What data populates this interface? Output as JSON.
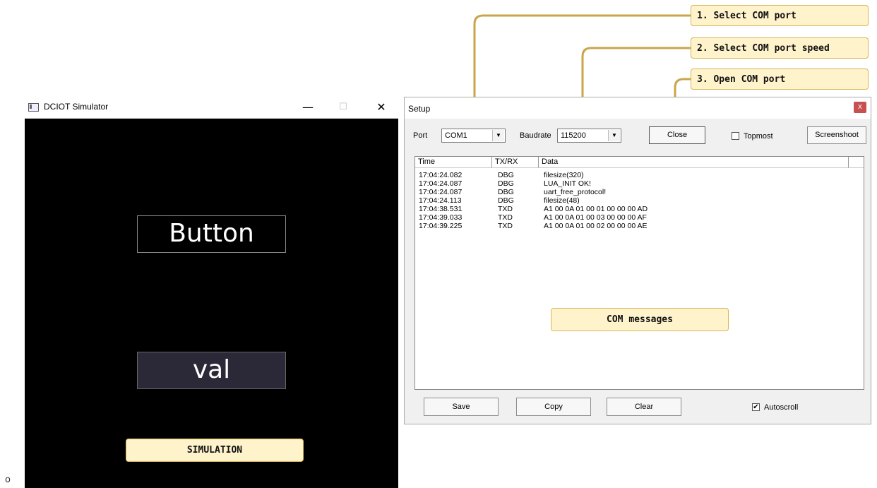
{
  "simulator": {
    "title": "DCIOT Simulator",
    "minimize_glyph": "—",
    "maximize_glyph": "☐",
    "close_glyph": "✕",
    "button_label": "Button",
    "val_label": "val"
  },
  "callouts": {
    "step1": "1. Select COM port",
    "step2": "2. Select COM port speed",
    "step3": "3. Open COM port",
    "messages": "COM messages",
    "simulation": "SIMULATION"
  },
  "setup": {
    "title": "Setup",
    "close_glyph": "x",
    "port_label": "Port",
    "port_value": "COM1",
    "baudrate_label": "Baudrate",
    "baudrate_value": "115200",
    "close_button": "Close",
    "topmost_label": "Topmost",
    "topmost_checked": false,
    "screenshoot_button": "Screenshoot",
    "columns": [
      "Time",
      "TX/RX",
      "Data"
    ],
    "rows": [
      {
        "time": "17:04:24.082",
        "dir": "DBG",
        "data": "filesize(320)"
      },
      {
        "time": "17:04:24.087",
        "dir": "DBG",
        "data": "LUA_INIT OK!"
      },
      {
        "time": "17:04:24.087",
        "dir": "DBG",
        "data": "uart_free_protocol!"
      },
      {
        "time": "17:04:24.113",
        "dir": "DBG",
        "data": "filesize(48)"
      },
      {
        "time": "17:04:38.531",
        "dir": "TXD",
        "data": "A1 00 0A 01 00 01 00 00 00 AD"
      },
      {
        "time": "17:04:39.033",
        "dir": "TXD",
        "data": "A1 00 0A 01 00 03 00 00 00 AF"
      },
      {
        "time": "17:04:39.225",
        "dir": "TXD",
        "data": "A1 00 0A 01 00 02 00 00 00 AE"
      }
    ],
    "save_button": "Save",
    "copy_button": "Copy",
    "clear_button": "Clear",
    "autoscroll_label": "Autoscroll",
    "autoscroll_checked": true
  },
  "stray_text": "o",
  "colors": {
    "callout_bg": "#fff3cc",
    "callout_border": "#d7b55a",
    "connector": "#c9a64a",
    "val_bg": "#2b2838"
  }
}
